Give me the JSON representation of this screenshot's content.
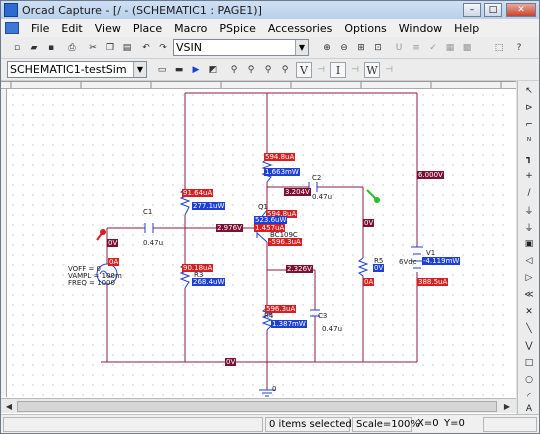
{
  "window": {
    "title": "Orcad Capture - [/ - (SCHEMATIC1 : PAGE1)]",
    "min_glyph": "–",
    "max_glyph": "□",
    "close_glyph": "✕"
  },
  "menu": [
    "File",
    "Edit",
    "View",
    "Place",
    "Macro",
    "PSpice",
    "Accessories",
    "Options",
    "Window",
    "Help"
  ],
  "toolbar1": {
    "part_combo_value": "VSIN"
  },
  "toolbar2": {
    "profile_combo_value": "SCHEMATIC1-testSim",
    "btn_v": "V",
    "btn_i": "I",
    "btn_w": "W"
  },
  "schematic": {
    "source": [
      "VOFF = 0",
      "VAMPL = 100m",
      "FREQ = 1000"
    ],
    "source_voltage": "0V",
    "source_current": "0A",
    "c1": {
      "name": "C1",
      "value": "0.47u"
    },
    "c2": {
      "name": "C2",
      "value": "0.47u"
    },
    "c3": {
      "name": "C3",
      "value": "0.47u"
    },
    "r_top": {
      "value": "1.663mW",
      "current": "594.8uA"
    },
    "r_left_top": {
      "current": "91.64uA",
      "power": "277.1uW"
    },
    "r_left_bot": {
      "name": "R3",
      "current": "90.18uA",
      "power": "268.4uW"
    },
    "q1": {
      "name": "Q1",
      "model": "BC109C",
      "ic": "594.8uA",
      "power": "523.6uW",
      "ib": "1.457uA",
      "ie": "-596.3uA"
    },
    "r4": {
      "name": "R4",
      "current": "596.3uA",
      "power": "1.387mW"
    },
    "r5": {
      "name": "R5",
      "voltage": "0V",
      "current": "0A"
    },
    "v1": {
      "name": "V1",
      "value": "6Vdc",
      "power": "-4.119mW",
      "current": "388.5uA"
    },
    "nodes": {
      "vcc": "6.000V",
      "collector": "3.204V",
      "base": "2.976V",
      "emitter": "2.326V",
      "out": "0V",
      "gnd": "0V",
      "gnd_label": "0"
    }
  },
  "status": {
    "selected": "0 items selected",
    "scale": "Scale=100%",
    "x": "X=0",
    "y": "Y=0"
  },
  "colors": {
    "wire": "#8b1a4a",
    "current": "#d42020",
    "power": "#1d3fd6",
    "voltage": "#7a1130"
  }
}
